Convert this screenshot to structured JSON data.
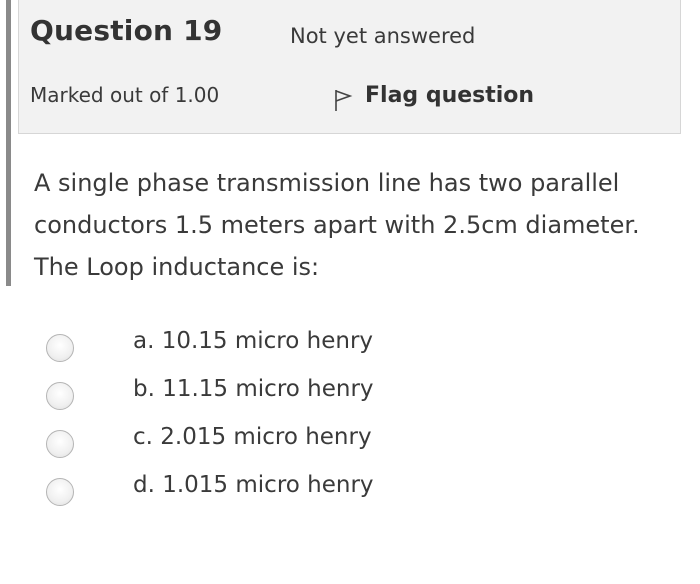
{
  "question": {
    "title": "Question 19",
    "state": "Not yet answered",
    "grade": "Marked out of 1.00",
    "flag_label": "Flag question",
    "text": "A single phase transmission line has two parallel conductors 1.5 meters apart with 2.5cm diameter. The Loop inductance is:"
  },
  "answers": [
    {
      "label": "a. 10.15 micro henry",
      "selected": false
    },
    {
      "label": "b. 11.15 micro henry",
      "selected": false
    },
    {
      "label": "c. 2.015 micro henry",
      "selected": false
    },
    {
      "label": "d. 1.015 micro henry",
      "selected": false
    }
  ],
  "icons": {
    "flag": "flag-icon"
  },
  "colors": {
    "info_background": "#f2f2f2",
    "left_rule": "#8a8a8a",
    "text": "#3a3a3a"
  }
}
